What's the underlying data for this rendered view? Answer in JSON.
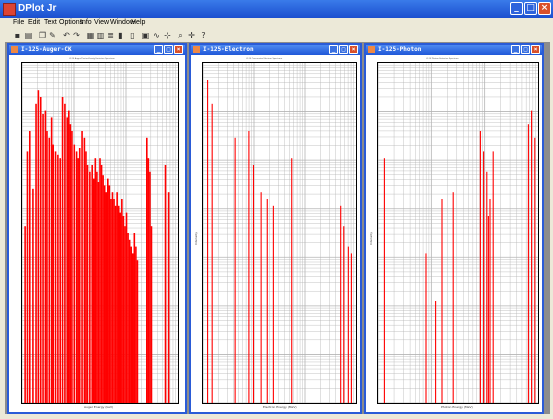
{
  "app": {
    "title": "DPlot Jr"
  },
  "menu": [
    "File",
    "Edit",
    "Text",
    "Options",
    "Info",
    "View",
    "Window",
    "Help"
  ],
  "toolbar_icons": [
    "save-icon",
    "print-icon",
    "copy-icon",
    "paste-icon",
    "undo-icon",
    "redo-icon",
    "grid-icon",
    "table-icon",
    "list-icon",
    "bars-icon",
    "columns-icon",
    "image-icon",
    "line-chart-icon",
    "fit-icon",
    "zoom-icon",
    "pan-icon",
    "help-icon"
  ],
  "colors": {
    "accent": "#2a5bd7",
    "series": "#ff0000",
    "grid": "#b4b4b4"
  },
  "windows": [
    {
      "title": "I-125-Auger-CK",
      "plot_title": "I-125 Auger/Coster-Kronig Emission Spectrum",
      "xlabel": "Auger Energy (keV)",
      "ylabel": ""
    },
    {
      "title": "I-125-Electron",
      "plot_title": "I-125 Conversion Electron Spectrum",
      "xlabel": "Electron Energy (MeV)",
      "ylabel": "Intensity"
    },
    {
      "title": "I-125-Photon",
      "plot_title": "I-125 Photon Emission Spectrum",
      "xlabel": "Photon Energy (MeV)",
      "ylabel": "Intensity"
    }
  ],
  "chart_data": [
    {
      "type": "bar",
      "series": [
        {
          "values": [
            [
              0.02,
              0.52
            ],
            [
              0.035,
              0.74
            ],
            [
              0.05,
              0.8
            ],
            [
              0.07,
              0.63
            ],
            [
              0.09,
              0.88
            ],
            [
              0.105,
              0.92
            ],
            [
              0.12,
              0.9
            ],
            [
              0.135,
              0.85
            ],
            [
              0.15,
              0.86
            ],
            [
              0.16,
              0.8
            ],
            [
              0.175,
              0.78
            ],
            [
              0.19,
              0.84
            ],
            [
              0.2,
              0.76
            ],
            [
              0.215,
              0.74
            ],
            [
              0.23,
              0.73
            ],
            [
              0.245,
              0.72
            ],
            [
              0.26,
              0.9
            ],
            [
              0.275,
              0.88
            ],
            [
              0.29,
              0.84
            ],
            [
              0.3,
              0.86
            ],
            [
              0.31,
              0.82
            ],
            [
              0.32,
              0.8
            ],
            [
              0.335,
              0.76
            ],
            [
              0.35,
              0.74
            ],
            [
              0.36,
              0.72
            ],
            [
              0.37,
              0.75
            ],
            [
              0.385,
              0.8
            ],
            [
              0.4,
              0.78
            ],
            [
              0.41,
              0.74
            ],
            [
              0.42,
              0.7
            ],
            [
              0.435,
              0.68
            ],
            [
              0.45,
              0.7
            ],
            [
              0.46,
              0.66
            ],
            [
              0.47,
              0.72
            ],
            [
              0.48,
              0.68
            ],
            [
              0.49,
              0.65
            ],
            [
              0.5,
              0.72
            ],
            [
              0.51,
              0.7
            ],
            [
              0.52,
              0.67
            ],
            [
              0.53,
              0.64
            ],
            [
              0.54,
              0.62
            ],
            [
              0.55,
              0.66
            ],
            [
              0.56,
              0.64
            ],
            [
              0.57,
              0.6
            ],
            [
              0.58,
              0.62
            ],
            [
              0.59,
              0.6
            ],
            [
              0.6,
              0.58
            ],
            [
              0.61,
              0.62
            ],
            [
              0.62,
              0.58
            ],
            [
              0.63,
              0.56
            ],
            [
              0.64,
              0.6
            ],
            [
              0.65,
              0.55
            ],
            [
              0.66,
              0.52
            ],
            [
              0.67,
              0.56
            ],
            [
              0.68,
              0.5
            ],
            [
              0.69,
              0.48
            ],
            [
              0.7,
              0.46
            ],
            [
              0.71,
              0.44
            ],
            [
              0.72,
              0.5
            ],
            [
              0.73,
              0.46
            ],
            [
              0.74,
              0.42
            ],
            [
              0.8,
              0.78
            ],
            [
              0.81,
              0.72
            ],
            [
              0.82,
              0.68
            ],
            [
              0.83,
              0.52
            ],
            [
              0.92,
              0.7
            ],
            [
              0.94,
              0.62
            ]
          ]
        }
      ]
    },
    {
      "type": "bar",
      "series": [
        {
          "values": [
            [
              0.03,
              0.95
            ],
            [
              0.06,
              0.88
            ],
            [
              0.21,
              0.78
            ],
            [
              0.3,
              0.8
            ],
            [
              0.33,
              0.7
            ],
            [
              0.38,
              0.62
            ],
            [
              0.42,
              0.6
            ],
            [
              0.46,
              0.58
            ],
            [
              0.58,
              0.72
            ],
            [
              0.9,
              0.58
            ],
            [
              0.92,
              0.52
            ],
            [
              0.95,
              0.46
            ],
            [
              0.97,
              0.44
            ]
          ]
        }
      ]
    },
    {
      "type": "bar",
      "series": [
        {
          "values": [
            [
              0.04,
              0.72
            ],
            [
              0.3,
              0.44
            ],
            [
              0.36,
              0.3
            ],
            [
              0.4,
              0.6
            ],
            [
              0.47,
              0.62
            ],
            [
              0.64,
              0.8
            ],
            [
              0.66,
              0.74
            ],
            [
              0.68,
              0.68
            ],
            [
              0.69,
              0.55
            ],
            [
              0.7,
              0.6
            ],
            [
              0.72,
              0.74
            ],
            [
              0.94,
              0.82
            ],
            [
              0.96,
              0.86
            ],
            [
              0.98,
              0.78
            ]
          ]
        }
      ]
    }
  ]
}
